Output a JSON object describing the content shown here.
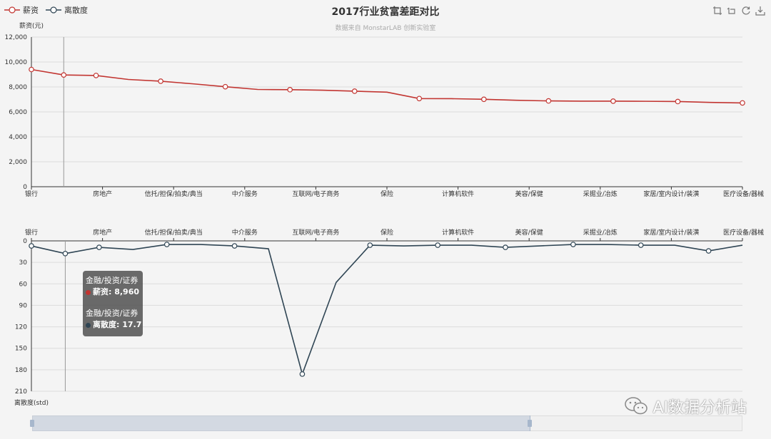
{
  "title": "2017行业贫富差距对比",
  "subtitle": "数据来自 MonstarLAB 创新实验室",
  "legend": [
    {
      "name": "薪资",
      "color": "#c23531"
    },
    {
      "name": "离散度",
      "color": "#2f4554"
    }
  ],
  "toolbox": [
    "zoom-icon",
    "zoom-reset-icon",
    "restore-icon",
    "save-image-icon"
  ],
  "chart_data": [
    {
      "type": "line",
      "ylabel": "薪资(元)",
      "ylim": [
        0,
        12000
      ],
      "yticks": [
        "0",
        "2,000",
        "4,000",
        "6,000",
        "8,000",
        "10,000",
        "12,000"
      ],
      "grid": true,
      "category_labels": [
        "银行",
        "房地产",
        "信托/担保/拍卖/典当",
        "中介服务",
        "互联网/电子商务",
        "保险",
        "计算机软件",
        "美容/保健",
        "采掘业/冶炼",
        "家居/室内设计/装潢",
        "医疗设备/器械"
      ],
      "series": [
        {
          "name": "薪资",
          "color": "#c23531",
          "values": [
            9400,
            8960,
            8920,
            8600,
            8460,
            8250,
            8020,
            7800,
            7780,
            7740,
            7660,
            7580,
            7070,
            7060,
            7010,
            6930,
            6880,
            6860,
            6860,
            6850,
            6830,
            6760,
            6720
          ]
        }
      ]
    },
    {
      "type": "line",
      "ylabel": "离散度(std)",
      "ylim": [
        0,
        210
      ],
      "inverse": true,
      "yticks": [
        "0",
        "30",
        "60",
        "90",
        "120",
        "150",
        "180",
        "210"
      ],
      "grid": true,
      "category_labels": [
        "银行",
        "房地产",
        "信托/担保/拍卖/典当",
        "中介服务",
        "互联网/电子商务",
        "保险",
        "计算机软件",
        "美容/保健",
        "采掘业/冶炼",
        "家居/室内设计/装潢",
        "医疗设备/器械"
      ],
      "series": [
        {
          "name": "离散度",
          "color": "#2f4554",
          "values": [
            7,
            17.7,
            9,
            12,
            5,
            5,
            7,
            11,
            186,
            58,
            6,
            7,
            6,
            6,
            9,
            7,
            5,
            5,
            6,
            6,
            14,
            6
          ]
        }
      ]
    }
  ],
  "tooltip": {
    "category": "金融/投资/证券",
    "entries": [
      {
        "category": "金融/投资/证券",
        "label": "薪资: 8,960",
        "color": "#c23531"
      },
      {
        "category": "金融/投资/证券",
        "label": "离散度: 17.7",
        "color": "#2f4554"
      }
    ]
  },
  "zoom": {
    "start_percent": 0,
    "end_percent": 70
  },
  "watermark": "AI数据分析站"
}
